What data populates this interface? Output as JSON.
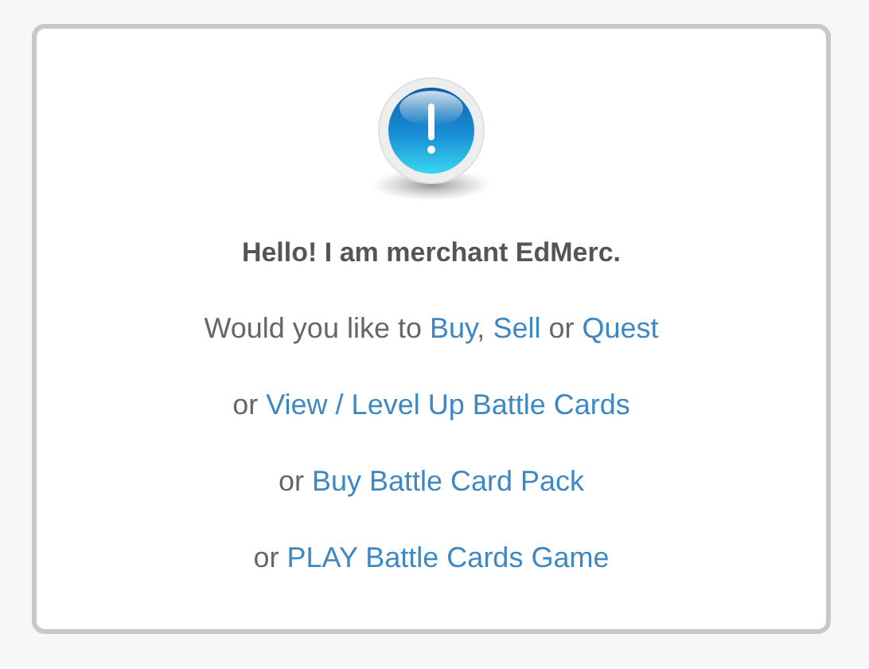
{
  "dialog": {
    "greeting": "Hello! I am merchant EdMerc.",
    "lines": [
      [
        {
          "kind": "text",
          "text": "Would you like to "
        },
        {
          "kind": "link",
          "text": "Buy"
        },
        {
          "kind": "text",
          "text": ", "
        },
        {
          "kind": "link",
          "text": "Sell"
        },
        {
          "kind": "text",
          "text": " or "
        },
        {
          "kind": "link",
          "text": "Quest"
        }
      ],
      [
        {
          "kind": "text",
          "text": "or "
        },
        {
          "kind": "link",
          "text": "View / Level Up Battle Cards"
        }
      ],
      [
        {
          "kind": "text",
          "text": "or "
        },
        {
          "kind": "link",
          "text": "Buy Battle Card Pack"
        }
      ],
      [
        {
          "kind": "text",
          "text": "or "
        },
        {
          "kind": "link",
          "text": "PLAY Battle Cards Game"
        }
      ]
    ]
  }
}
